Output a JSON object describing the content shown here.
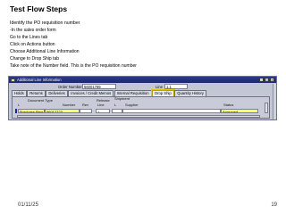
{
  "slide": {
    "title": "Test Flow Steps",
    "steps": [
      "Identify the PO requisition number",
      "-In the sales order form",
      "Go to the Lines tab",
      "Click on Actions button",
      "Choose Additional Line Information",
      "Change to Drop Ship tab",
      "Take note of the Number field. This is the PO requisition number"
    ],
    "footer_date": "01/11/25",
    "page_number": "19"
  },
  "window": {
    "title": "Additional Line Information",
    "header": {
      "order_number_label": "Order Number",
      "order_number": "56001789",
      "line_label": "Line",
      "line": "1.1"
    },
    "tabs": [
      "Holds",
      "Returns",
      "Deliveries",
      "Invoices / Credit Memos",
      "Internal Requisition",
      "Drop Ship",
      "Quantity History"
    ],
    "active_tab": "Drop Ship",
    "grid": {
      "headers": {
        "document_type": "Document Type",
        "l": "L",
        "number": "Number",
        "rev": "Rev",
        "release": "Release",
        "line": "Line",
        "shipment": "Shipment",
        "supplier_l": "L",
        "supplier": "Supplier",
        "status": "Status"
      },
      "row": {
        "document_type": "Purchase Requ",
        "number": "56012723",
        "line": "1",
        "supplier": "",
        "status": "Approved"
      }
    }
  },
  "colors": {
    "title_bar": "#1b2870",
    "highlight": "#ffff66",
    "active_tab_border": "#e3c800"
  }
}
